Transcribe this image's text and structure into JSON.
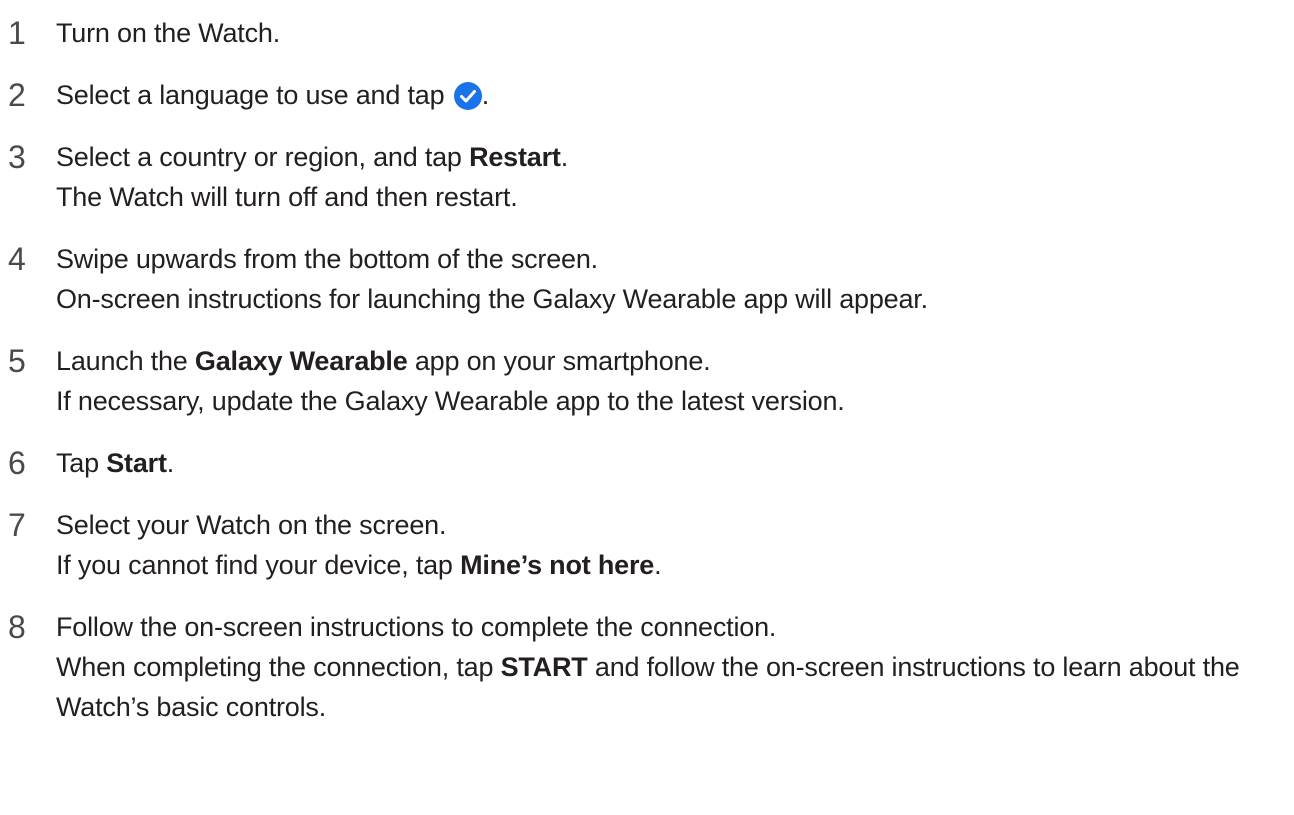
{
  "steps": [
    {
      "number": "1",
      "text": "Turn on the Watch."
    },
    {
      "number": "2",
      "before_icon": "Select a language to use and tap ",
      "icon": "check-circle-icon",
      "icon_color": "#1a73e8",
      "after_icon": "."
    },
    {
      "number": "3",
      "pre": "Select a country or region, and tap ",
      "bold": "Restart",
      "post": ".",
      "sub": "The Watch will turn off and then restart."
    },
    {
      "number": "4",
      "text": "Swipe upwards from the bottom of the screen.",
      "sub": "On-screen instructions for launching the Galaxy Wearable app will appear."
    },
    {
      "number": "5",
      "pre": "Launch the ",
      "bold": "Galaxy Wearable",
      "post": " app on your smartphone.",
      "sub": "If necessary, update the Galaxy Wearable app to the latest version."
    },
    {
      "number": "6",
      "pre": "Tap ",
      "bold": "Start",
      "post": "."
    },
    {
      "number": "7",
      "text": "Select your Watch on the screen.",
      "sub_pre": "If you cannot find your device, tap ",
      "sub_bold": "Mine’s not here",
      "sub_post": "."
    },
    {
      "number": "8",
      "text": "Follow the on-screen instructions to complete the connection.",
      "sub_pre": "When completing the connection, tap ",
      "sub_bold": "START",
      "sub_post": " and follow the on-screen instructions to learn about the Watch’s basic controls."
    }
  ]
}
